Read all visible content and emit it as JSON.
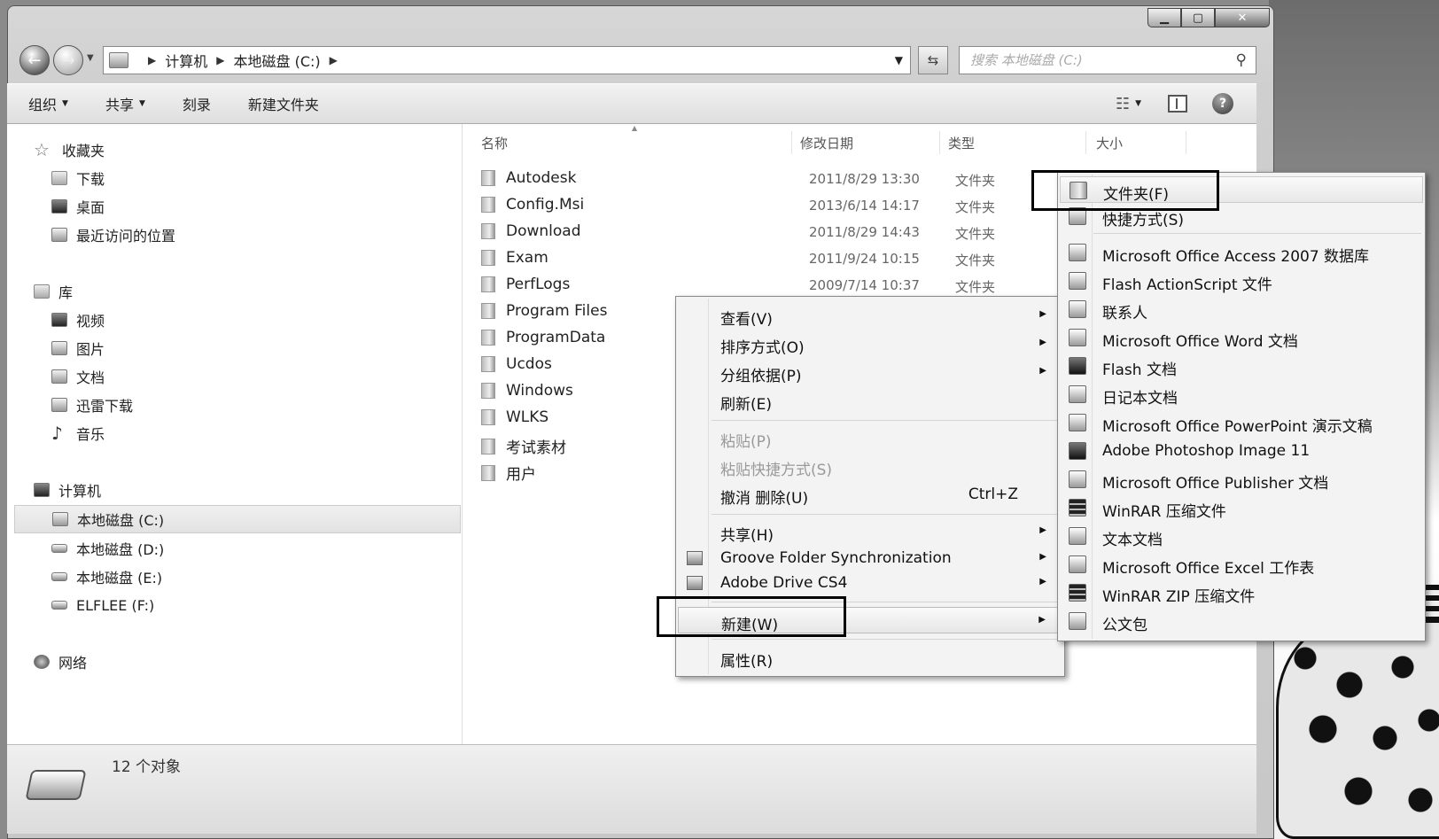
{
  "address": {
    "crumbs": [
      "计算机",
      "本地磁盘 (C:)"
    ],
    "search_placeholder": "搜索 本地磁盘 (C:)"
  },
  "toolbar": {
    "organize": "组织",
    "share": "共享",
    "burn": "刻录",
    "new_folder": "新建文件夹"
  },
  "nav": {
    "favorites": "收藏夹",
    "downloads": "下载",
    "desktop": "桌面",
    "recent": "最近访问的位置",
    "libraries": "库",
    "videos": "视频",
    "pictures": "图片",
    "documents": "文档",
    "thunder": "迅雷下载",
    "music": "音乐",
    "computer": "计算机",
    "drive_c": "本地磁盘 (C:)",
    "drive_d": "本地磁盘 (D:)",
    "drive_e": "本地磁盘 (E:)",
    "drive_f": "ELFLEE (F:)",
    "network": "网络"
  },
  "columns": {
    "name": "名称",
    "modified": "修改日期",
    "type": "类型",
    "size": "大小"
  },
  "files": [
    {
      "name": "Autodesk",
      "date": "2011/8/29 13:30",
      "type": "文件夹"
    },
    {
      "name": "Config.Msi",
      "date": "2013/6/14 14:17",
      "type": "文件夹"
    },
    {
      "name": "Download",
      "date": "2011/8/29 14:43",
      "type": "文件夹"
    },
    {
      "name": "Exam",
      "date": "2011/9/24 10:15",
      "type": "文件夹"
    },
    {
      "name": "PerfLogs",
      "date": "2009/7/14 10:37",
      "type": "文件夹"
    },
    {
      "name": "Program Files",
      "date": "",
      "type": ""
    },
    {
      "name": "ProgramData",
      "date": "",
      "type": ""
    },
    {
      "name": "Ucdos",
      "date": "",
      "type": ""
    },
    {
      "name": "Windows",
      "date": "",
      "type": ""
    },
    {
      "name": "WLKS",
      "date": "",
      "type": ""
    },
    {
      "name": "考试素材",
      "date": "",
      "type": ""
    },
    {
      "name": "用户",
      "date": "",
      "type": ""
    }
  ],
  "status": {
    "count": "12 个对象"
  },
  "context_menu": {
    "view": "查看(V)",
    "sort": "排序方式(O)",
    "group": "分组依据(P)",
    "refresh": "刷新(E)",
    "paste": "粘贴(P)",
    "paste_shortcut": "粘贴快捷方式(S)",
    "undo": "撤消 删除(U)",
    "undo_shortcut": "Ctrl+Z",
    "share": "共享(H)",
    "groove": "Groove Folder Synchronization",
    "adobe_drive": "Adobe Drive CS4",
    "new": "新建(W)",
    "properties": "属性(R)"
  },
  "new_submenu": [
    "文件夹(F)",
    "快捷方式(S)",
    "Microsoft Office Access 2007 数据库",
    "Flash ActionScript 文件",
    "联系人",
    "Microsoft Office Word 文档",
    "Flash 文档",
    "日记本文档",
    "Microsoft Office PowerPoint 演示文稿",
    "Adobe Photoshop Image 11",
    "Microsoft Office Publisher 文档",
    "WinRAR 压缩文件",
    "文本文档",
    "Microsoft Office Excel 工作表",
    "WinRAR ZIP 压缩文件",
    "公文包"
  ],
  "icons": {
    "back": "back-arrow-icon",
    "forward": "forward-arrow-icon",
    "search": "search-icon",
    "refresh": "refresh-icon",
    "help": "help-icon"
  }
}
